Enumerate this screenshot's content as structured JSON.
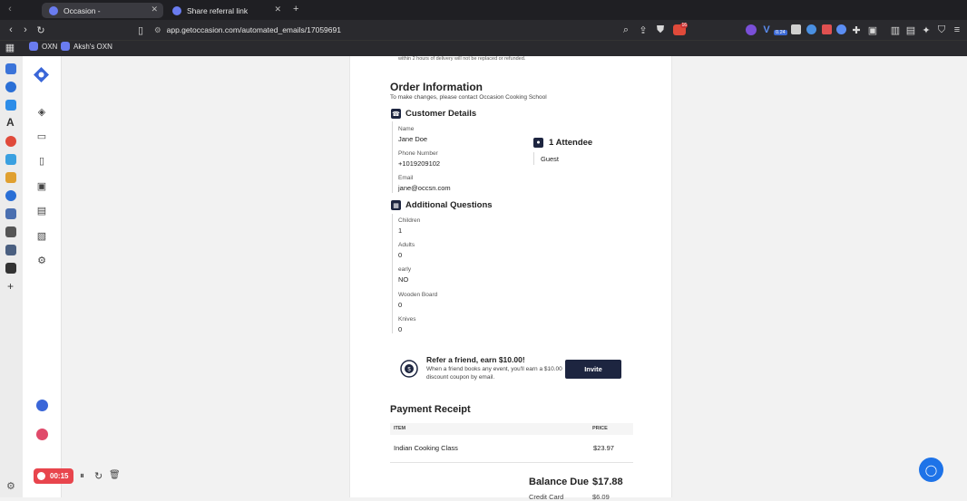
{
  "browser": {
    "tabs": [
      {
        "title": "Occasion -"
      },
      {
        "title": "Share referral link"
      }
    ],
    "new_tab": "+",
    "url": "app.getoccasion.com/automated_emails/17059691",
    "ext_badge": "0.24",
    "shield_count": "16",
    "bookmarks": [
      {
        "label": "OXN"
      },
      {
        "label": "Aksh's OXN"
      }
    ]
  },
  "email": {
    "top_note": "within 2 hours of delivery will not be replaced or refunded.",
    "order_title": "Order Information",
    "order_subtitle": "To make changes, please contact Occasion Cooking School",
    "customer_title": "Customer Details",
    "name_label": "Name",
    "name_value": "Jane Doe",
    "phone_label": "Phone Number",
    "phone_value": "+1019209102",
    "email_label": "Email",
    "email_value": "jane@occsn.com",
    "attendee_title": "1 Attendee",
    "attendee_name": "Guest",
    "questions_title": "Additional Questions",
    "questions": [
      {
        "q": "Children",
        "a": "1"
      },
      {
        "q": "Adults",
        "a": "0"
      },
      {
        "q": "early",
        "a": "NO"
      },
      {
        "q": "Wooden Board",
        "a": "0"
      },
      {
        "q": "Knives",
        "a": "0"
      }
    ],
    "referral_title": "Refer a friend, earn $10.00!",
    "referral_text1": "When a friend books any event, you'll earn a $10.00",
    "referral_text2": "discount coupon by email.",
    "invite_label": "Invite",
    "receipt_title": "Payment Receipt",
    "col_item": "ITEM",
    "col_price": "PRICE",
    "items": [
      {
        "name": "Indian Cooking Class",
        "price": "$23.97"
      }
    ],
    "balance_label": "Balance Due",
    "balance_value": "$17.88",
    "credit_label": "Credit Card",
    "credit_value": "$6.09"
  },
  "recorder": {
    "time": "00:15"
  },
  "colors": {
    "brand": "#1d2540",
    "record": "#e8454d",
    "help": "#1e73e8"
  }
}
